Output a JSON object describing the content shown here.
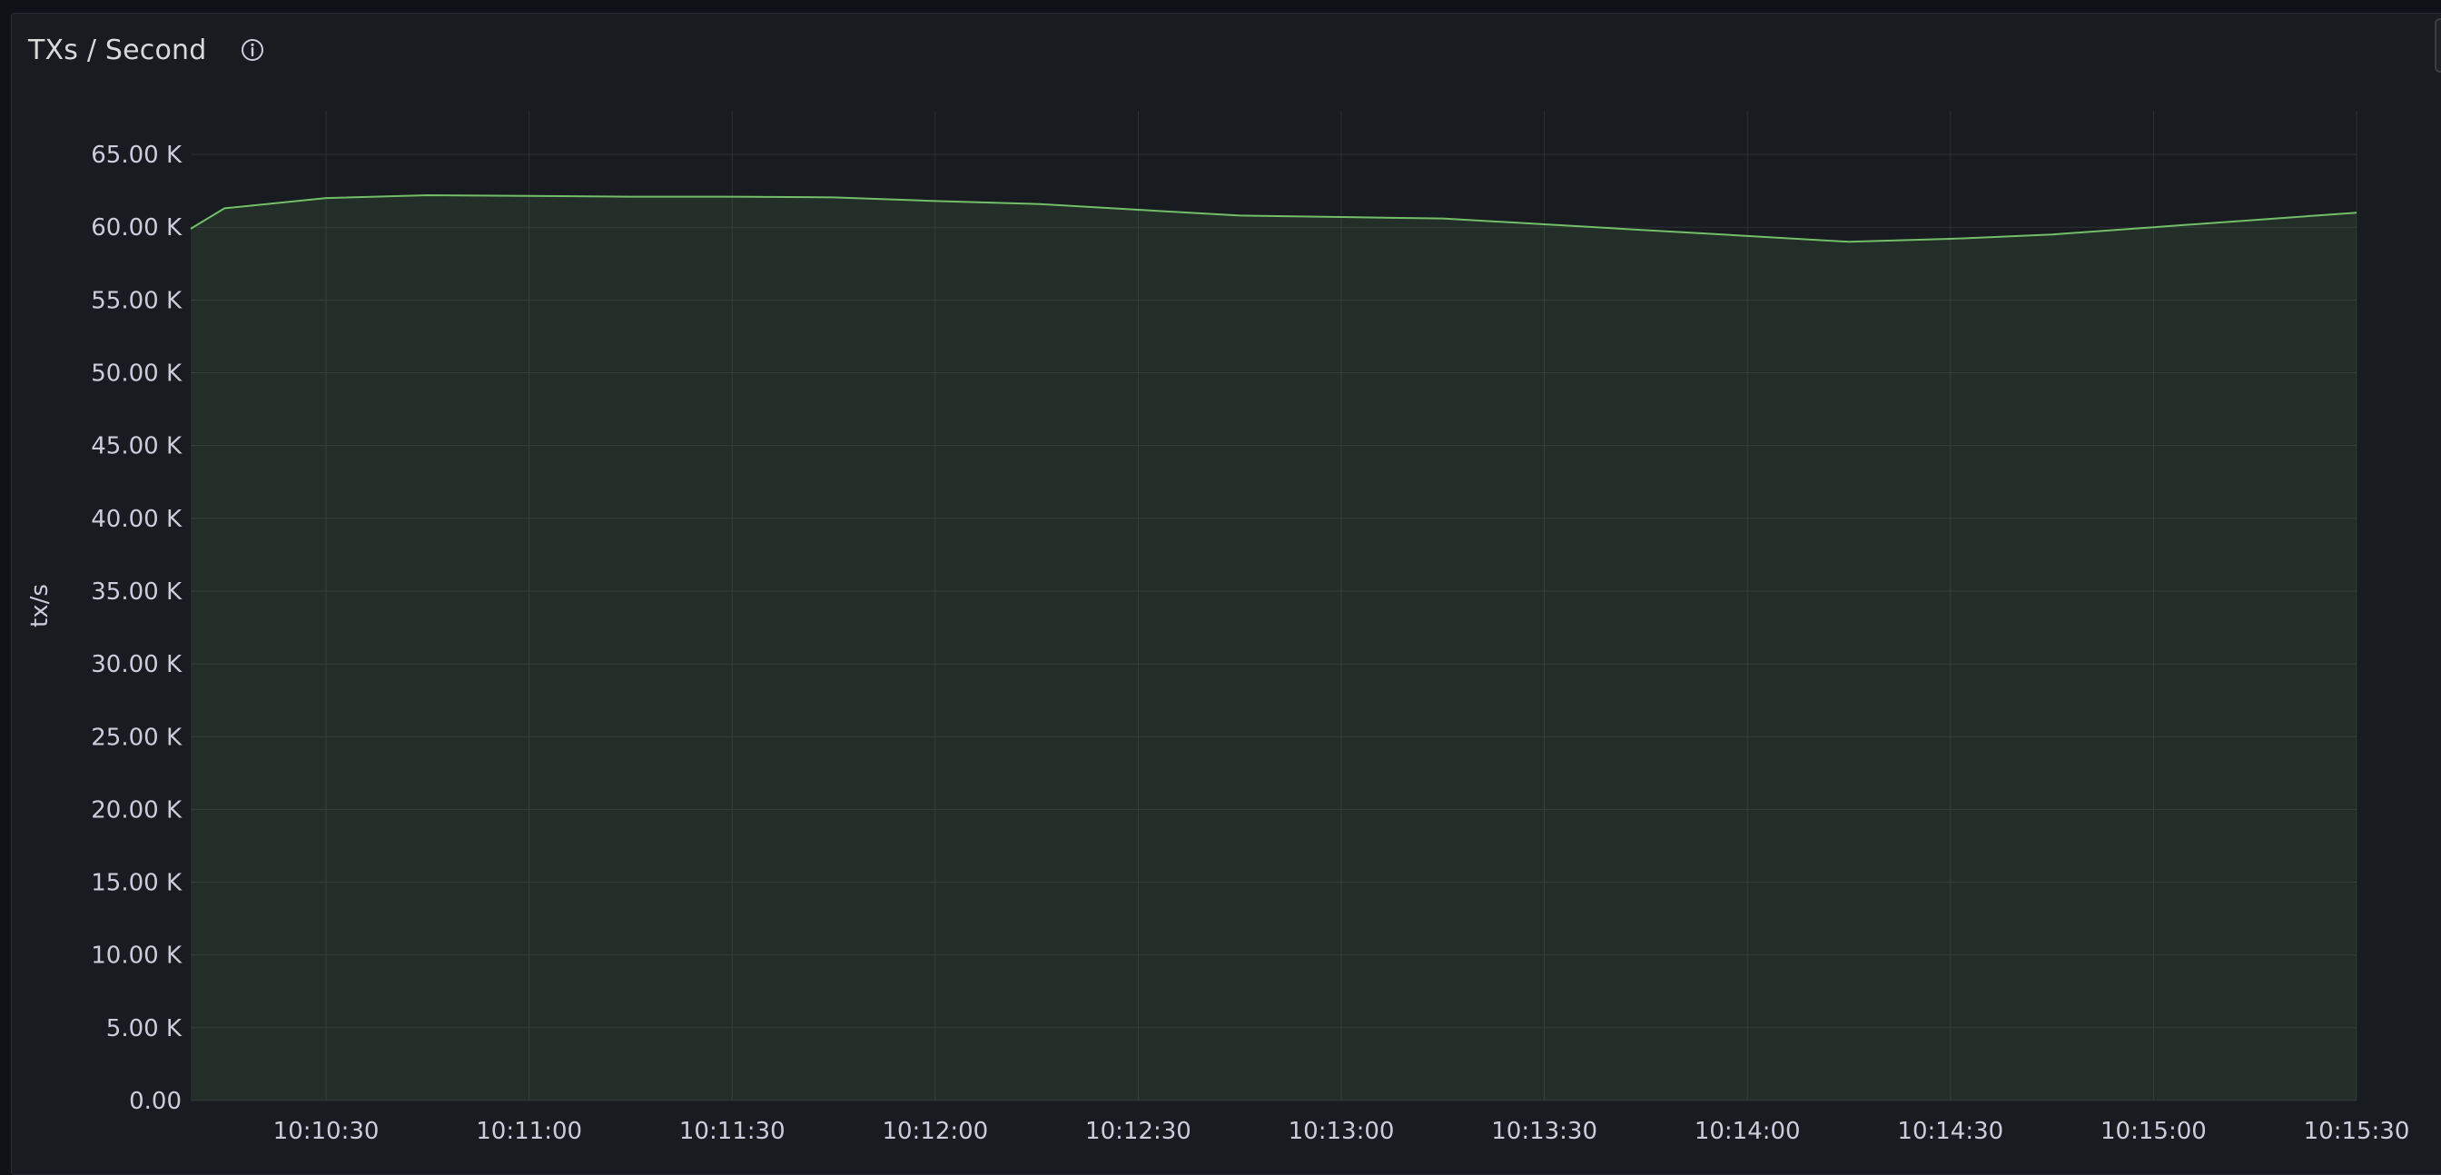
{
  "panel": {
    "title": "TXs / Second",
    "info_icon": "info-circle-icon"
  },
  "colors": {
    "background": "#111217",
    "panel": "#181b1f",
    "series_line": "#73bf69",
    "series_fill": "#73bf69",
    "grid": "#2c2f35",
    "text": "#ccccdc"
  },
  "chart_data": {
    "type": "area",
    "ylabel": "tx/s",
    "ylim": [
      0,
      68000
    ],
    "yticks": [
      0,
      5000,
      10000,
      15000,
      20000,
      25000,
      30000,
      35000,
      40000,
      45000,
      50000,
      55000,
      60000,
      65000
    ],
    "ytick_labels": [
      "0.00",
      "5.00 K",
      "10.00 K",
      "15.00 K",
      "20.00 K",
      "25.00 K",
      "30.00 K",
      "35.00 K",
      "40.00 K",
      "45.00 K",
      "50.00 K",
      "55.00 K",
      "60.00 K",
      "65.00 K"
    ],
    "xlim": [
      "10:10:10",
      "10:15:30"
    ],
    "xticks": [
      "10:10:30",
      "10:11:00",
      "10:11:30",
      "10:12:00",
      "10:12:30",
      "10:13:00",
      "10:13:30",
      "10:14:00",
      "10:14:30",
      "10:15:00",
      "10:15:30"
    ],
    "grid": true,
    "legend": "none",
    "series": [
      {
        "x": [
          "10:10:10",
          "10:10:15",
          "10:10:30",
          "10:10:45",
          "10:11:00",
          "10:11:15",
          "10:11:30",
          "10:11:45",
          "10:12:00",
          "10:12:15",
          "10:12:30",
          "10:12:45",
          "10:13:00",
          "10:13:15",
          "10:13:30",
          "10:13:45",
          "10:14:00",
          "10:14:15",
          "10:14:30",
          "10:14:45",
          "10:15:00",
          "10:15:15",
          "10:15:30"
        ],
        "values": [
          59900,
          61300,
          62000,
          62200,
          62150,
          62100,
          62100,
          62050,
          61800,
          61600,
          61200,
          60800,
          60700,
          60600,
          60200,
          59800,
          59400,
          59000,
          59200,
          59500,
          60000,
          60500,
          61000
        ]
      }
    ]
  }
}
